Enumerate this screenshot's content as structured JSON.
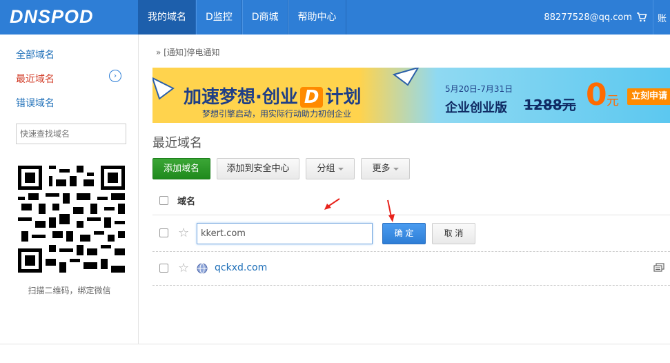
{
  "header": {
    "logo": "DNSPOD",
    "nav": [
      "我的域名",
      "D监控",
      "D商城",
      "帮助中心"
    ],
    "account_email": "88277528@qq.com",
    "account_more": "账"
  },
  "sidebar": {
    "items": [
      {
        "label": "全部域名",
        "active": false
      },
      {
        "label": "最近域名",
        "active": true
      },
      {
        "label": "错误域名",
        "active": false
      }
    ],
    "search_placeholder": "快速查找域名",
    "qr_caption": "扫描二维码，绑定微信"
  },
  "main": {
    "breadcrumb": "» [通知]停电通知",
    "banner": {
      "headline": "加速梦想·创业",
      "headline_d": "D",
      "headline_end": "计划",
      "subline": "梦想引擎启动，用实际行动助力初创企业",
      "date_range": "5月20日-7月31日",
      "edition": "企业创业版",
      "old_price": "1288元",
      "new_price": "0",
      "new_price_unit": "元",
      "cta": "立刻申请"
    },
    "title": "最近域名",
    "toolbar": {
      "add_domain": "添加域名",
      "add_security": "添加到安全中心",
      "group": "分组",
      "more": "更多"
    },
    "table": {
      "column_domain": "域名",
      "edit_row": {
        "input_value": "kkert.com",
        "confirm_label": "确 定",
        "cancel_label": "取 消"
      },
      "rows": [
        {
          "domain": "qckxd.com"
        }
      ]
    }
  },
  "colors": {
    "header_bg": "#2e7ed6",
    "active_nav": "#1d5fac",
    "add_button": "#1f8a1d",
    "confirm_button": "#2e7ed6",
    "active_sidebar": "#d3402c",
    "link": "#1e6fb8",
    "annotation_arrow": "#e8231c"
  }
}
